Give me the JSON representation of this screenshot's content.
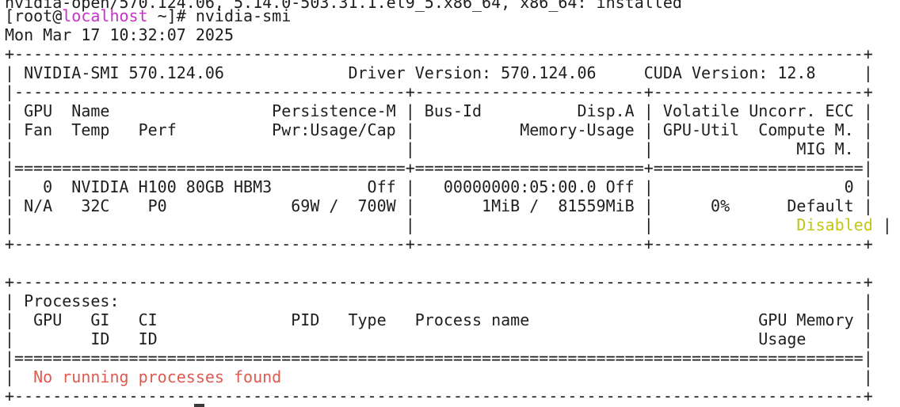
{
  "header": {
    "partial_line": "nvidia-open/570.124.06, 5.14.0-503.31.1.el9_5.x86_64, x86_64: installed",
    "prompt_open": "[root@",
    "prompt_host": "localhost",
    "prompt_close": " ~]# ",
    "command": "nvidia-smi",
    "timestamp": "Mon Mar 17 10:32:07 2025"
  },
  "smi": {
    "border_top": "+-----------------------------------------------------------------------------------------+",
    "version_row": "| NVIDIA-SMI 570.124.06             Driver Version: 570.124.06     CUDA Version: 12.8     |",
    "sep_dashed": "|-----------------------------------------+------------------------+----------------------+",
    "header_row_1": "| GPU  Name                 Persistence-M | Bus-Id          Disp.A | Volatile Uncorr. ECC |",
    "header_row_2": "| Fan  Temp   Perf          Pwr:Usage/Cap |           Memory-Usage | GPU-Util  Compute M. |",
    "header_row_3": "|                                         |                        |               MIG M. |",
    "sep_double": "|=========================================+========================+======================|",
    "gpu_row_1": "|   0  NVIDIA H100 80GB HBM3          Off |   00000000:05:00.0 Off |                    0 |",
    "gpu_row_2": "| N/A   32C    P0             69W /  700W |       1MiB /  81559MiB |      0%      Default |",
    "gpu_row_3_left": "|                                         |                        |               ",
    "mig_mode": "Disabled",
    "gpu_row_3_right": " |",
    "border_mid": "+-----------------------------------------+------------------------+----------------------+"
  },
  "processes": {
    "border_top": "+-----------------------------------------------------------------------------------------+",
    "title_row": "| Processes:                                                                              |",
    "header_row_1": "|  GPU   GI   CI              PID   Type   Process name                        GPU Memory |",
    "header_row_2": "|        ID   ID                                                               Usage      |",
    "sep_double": "|=========================================================================================|",
    "empty_row_left": "|  ",
    "empty_message": "No running processes found",
    "empty_row_right": "                                                             |",
    "border_bottom": "+-----------------------------------------------------------------------------------------+"
  }
}
